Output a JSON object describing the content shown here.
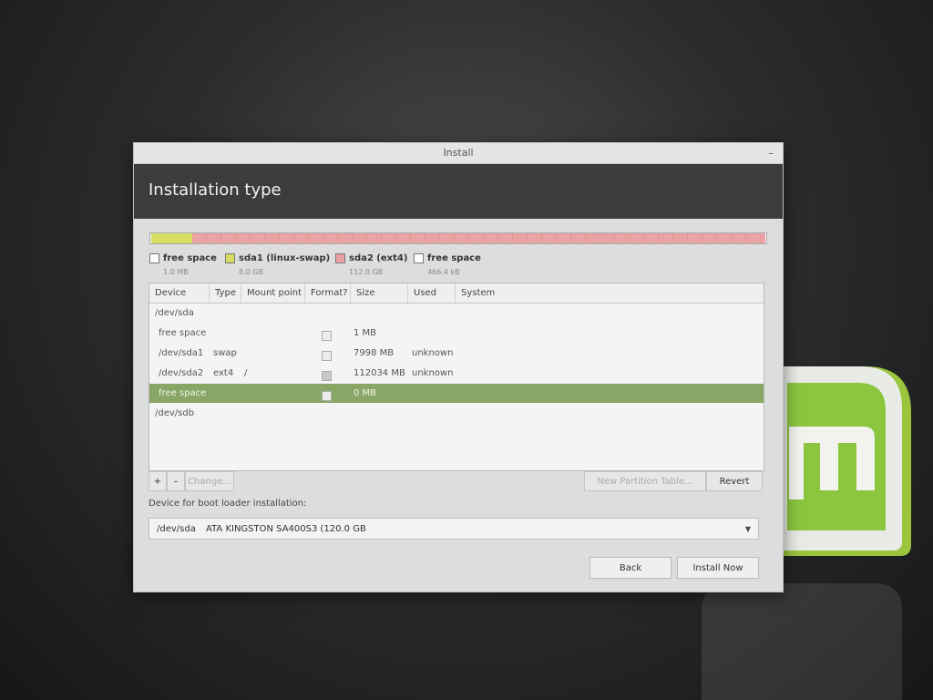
{
  "window": {
    "title": "Install",
    "minimize_glyph": "–"
  },
  "header": {
    "title": "Installation type"
  },
  "legend": [
    {
      "name": "free space",
      "size": "1.0 MB",
      "color": "#ffffff"
    },
    {
      "name": "sda1 (linux-swap)",
      "size": "8.0 GB",
      "color": "#d6dd62"
    },
    {
      "name": "sda2 (ext4)",
      "size": "112.0 GB",
      "color": "#e8a1a3"
    },
    {
      "name": "free space",
      "size": "466.4 kB",
      "color": "#ffffff"
    }
  ],
  "table": {
    "columns": [
      "Device",
      "Type",
      "Mount point",
      "Format?",
      "Size",
      "Used",
      "System"
    ],
    "rows": [
      {
        "device": "/dev/sda",
        "type": "",
        "mount": "",
        "format": null,
        "size": "",
        "used": "",
        "system": ""
      },
      {
        "device": "free space",
        "type": "",
        "mount": "",
        "format": false,
        "size": "1 MB",
        "used": "",
        "system": ""
      },
      {
        "device": "/dev/sda1",
        "type": "swap",
        "mount": "",
        "format": false,
        "size": "7998 MB",
        "used": "unknown",
        "system": ""
      },
      {
        "device": "/dev/sda2",
        "type": "ext4",
        "mount": "/",
        "format": true,
        "size": "112034 MB",
        "used": "unknown",
        "system": ""
      },
      {
        "device": "free space",
        "type": "",
        "mount": "",
        "format": false,
        "size": "0 MB",
        "used": "",
        "system": "",
        "selected": true
      },
      {
        "device": "/dev/sdb",
        "type": "",
        "mount": "",
        "format": null,
        "size": "",
        "used": "",
        "system": ""
      }
    ]
  },
  "buttons": {
    "add": "+",
    "remove": "–",
    "change": "Change...",
    "new_partition_table": "New Partition Table...",
    "revert": "Revert",
    "back": "Back",
    "install_now": "Install Now"
  },
  "boot": {
    "label": "Device for boot loader installation:",
    "device": "/dev/sda",
    "description": "ATA KINGSTON SA400S3 (120.0 GB"
  },
  "colors": {
    "accent": "#88a665",
    "header_bg": "#3b3d3c",
    "mint_green": "#8cc63f"
  }
}
